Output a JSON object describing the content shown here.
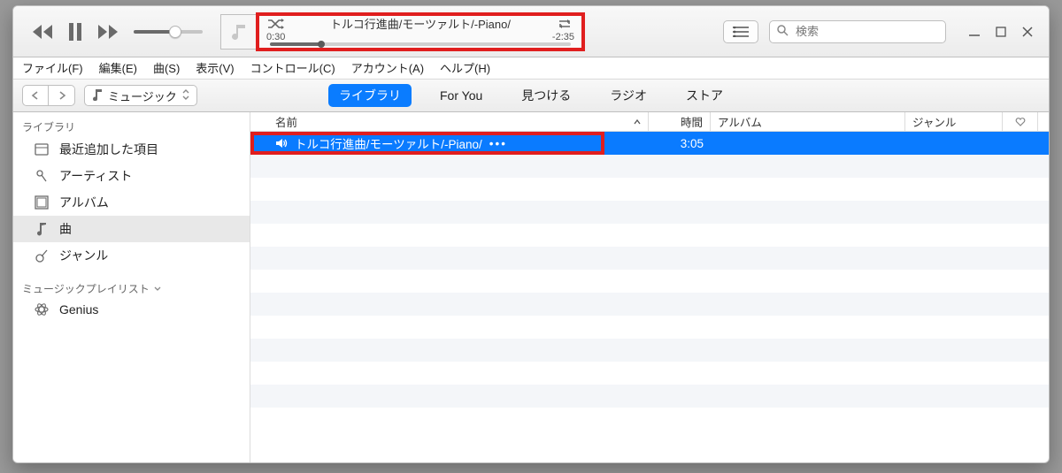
{
  "nowplaying": {
    "title": "トルコ行進曲/モーツァルト/-Piano/",
    "elapsed": "0:30",
    "remaining": "-2:35"
  },
  "search": {
    "placeholder": "検索"
  },
  "menubar": {
    "file": "ファイル(F)",
    "edit": "編集(E)",
    "song": "曲(S)",
    "view": "表示(V)",
    "control": "コントロール(C)",
    "account": "アカウント(A)",
    "help": "ヘルプ(H)"
  },
  "subbar": {
    "source_label": "ミュージック",
    "tabs": {
      "library": "ライブラリ",
      "foryou": "For You",
      "browse": "見つける",
      "radio": "ラジオ",
      "store": "ストア"
    }
  },
  "sidebar": {
    "library_header": "ライブラリ",
    "items": {
      "recent": "最近追加した項目",
      "artist": "アーティスト",
      "album": "アルバム",
      "songs": "曲",
      "genre": "ジャンル"
    },
    "playlists_header": "ミュージックプレイリスト",
    "genius": "Genius"
  },
  "columns": {
    "name": "名前",
    "time": "時間",
    "album": "アルバム",
    "genre": "ジャンル"
  },
  "track": {
    "name_display": "トルコ行進曲/モーツァルト/-Piano/",
    "duration": "3:05"
  }
}
